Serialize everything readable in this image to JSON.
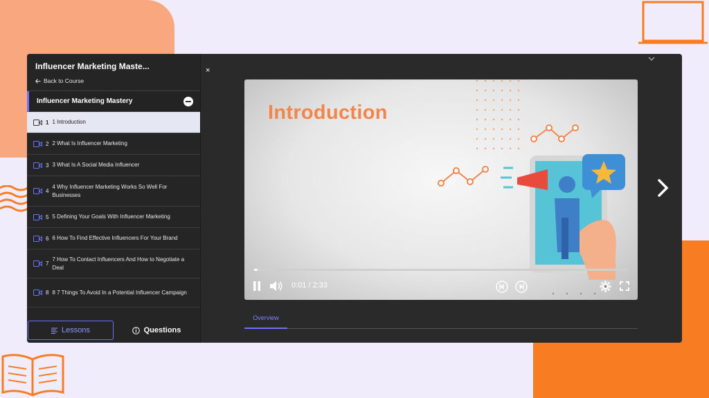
{
  "sidebar": {
    "course_title": "Influencer Marketing Maste...",
    "back_label": "Back to Course",
    "section_title": "Influencer Marketing Mastery",
    "lessons": [
      {
        "num": "1",
        "label": "1 Introduction"
      },
      {
        "num": "2",
        "label": "2 What Is Influencer Marketing"
      },
      {
        "num": "3",
        "label": "3 What Is A Social Media Influencer"
      },
      {
        "num": "4",
        "label": "4 Why Influencer Marketing Works So Well For Businesses"
      },
      {
        "num": "5",
        "label": "5 Defining Your Goals With Influencer Marketing"
      },
      {
        "num": "6",
        "label": "6 How To Find Effective Influencers For Your Brand"
      },
      {
        "num": "7",
        "label": "7 How To Contact Influencers And How to Negotiate a Deal"
      },
      {
        "num": "8",
        "label": "8 7 Things To Avoid In a Potential Influencer Campaign"
      }
    ],
    "tab_lessons": "Lessons",
    "tab_questions": "Questions"
  },
  "close_glyph": "×",
  "video": {
    "slide_title": "Introduction",
    "time_current": "0:01",
    "time_total": "/ 2:33",
    "progress": 0.007
  },
  "tabs": {
    "overview": "Overview"
  },
  "colors": {
    "accent": "#6b74ff",
    "orange": "#f77c22",
    "panel": "#2a2a2b"
  }
}
